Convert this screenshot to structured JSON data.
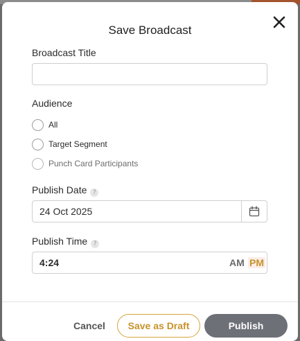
{
  "modal": {
    "title": "Save Broadcast"
  },
  "broadcast_title": {
    "label": "Broadcast Title",
    "value": "",
    "placeholder": ""
  },
  "audience": {
    "label": "Audience",
    "options": [
      {
        "label": "All",
        "selected": false
      },
      {
        "label": "Target Segment",
        "selected": false
      },
      {
        "label": "Punch Card Participants",
        "selected": false
      }
    ]
  },
  "publish_date": {
    "label": "Publish Date",
    "value": "24 Oct 2025",
    "help": "?"
  },
  "publish_time": {
    "label": "Publish Time",
    "value": "4:24",
    "am_label": "AM",
    "pm_label": "PM",
    "selected_period": "PM",
    "help": "?"
  },
  "footer": {
    "cancel_label": "Cancel",
    "draft_label": "Save as Draft",
    "publish_label": "Publish"
  },
  "colors": {
    "accent": "#c7922a",
    "publish_button": "#6e7078",
    "backdrop_accent": "#a3542c"
  },
  "icons": {
    "close": "close-icon",
    "calendar": "calendar-icon",
    "help": "help-icon"
  }
}
